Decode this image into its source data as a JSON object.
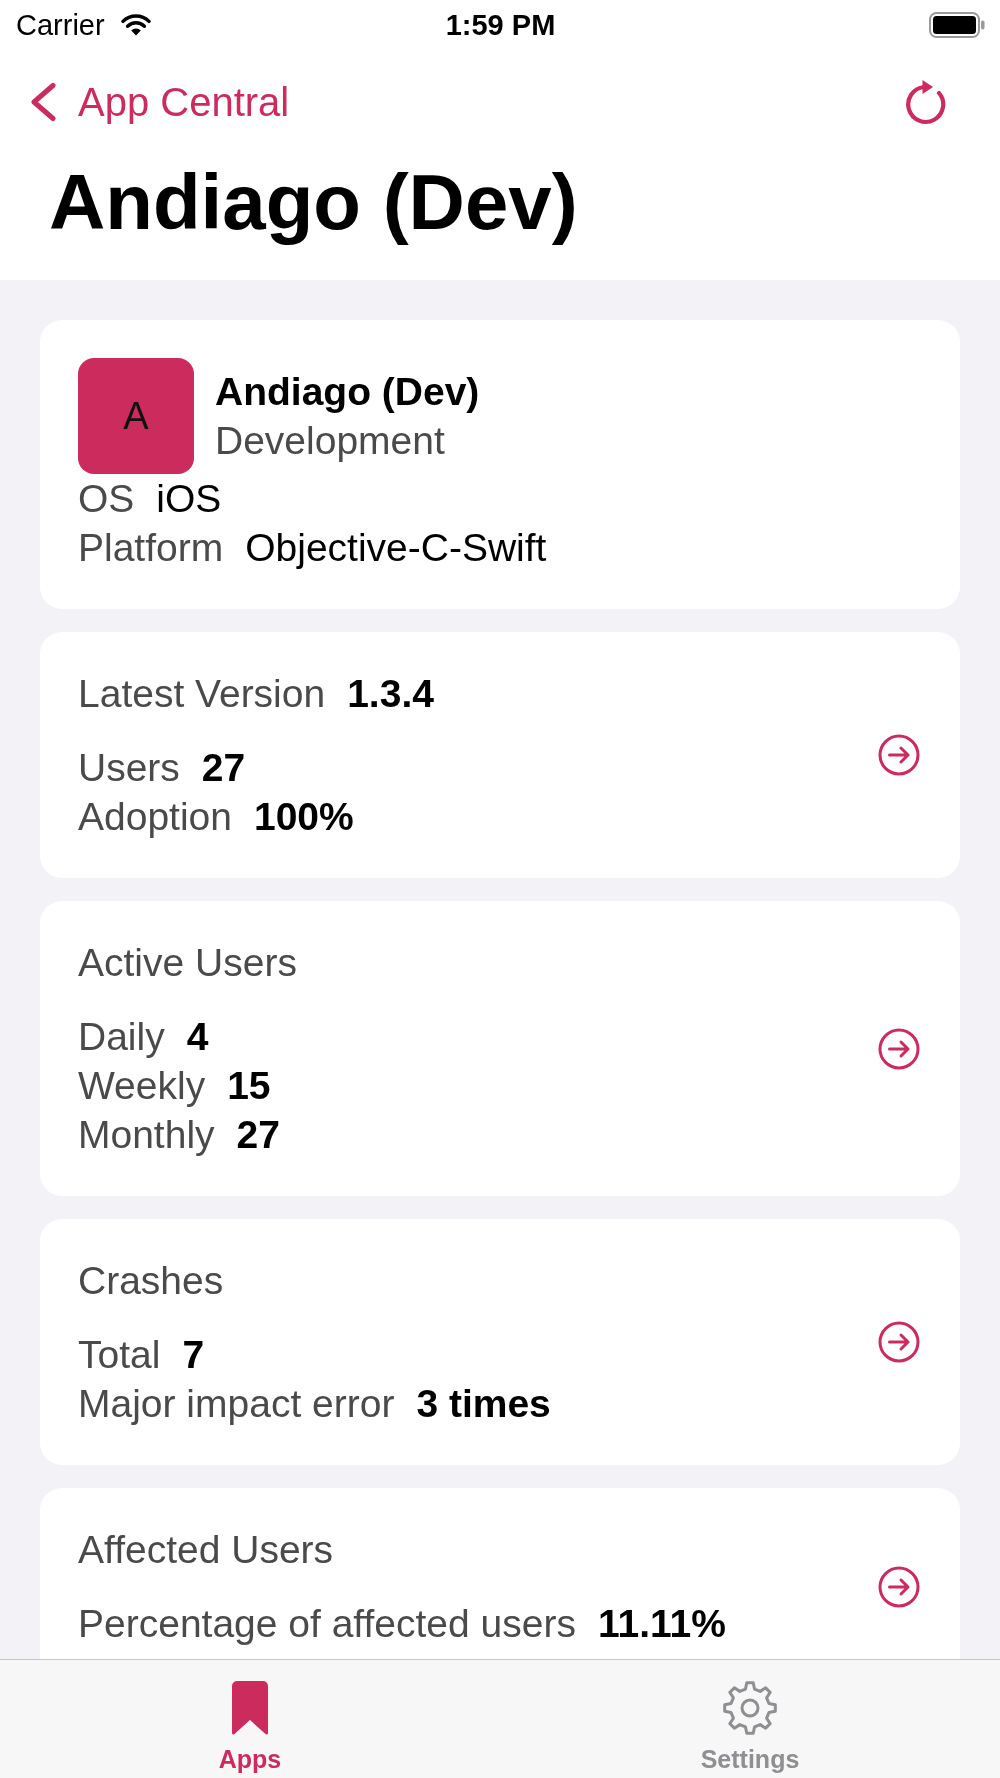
{
  "status_bar": {
    "carrier": "Carrier",
    "time": "1:59 PM"
  },
  "nav_bar": {
    "back_label": "App Central",
    "title": "Andiago (Dev)"
  },
  "app_card": {
    "initial": "A",
    "name": "Andiago (Dev)",
    "environment": "Development",
    "fields": [
      {
        "label": "OS",
        "value": "iOS"
      },
      {
        "label": "Platform",
        "value": "Objective-C-Swift"
      }
    ]
  },
  "stat_cards": [
    {
      "title": "Latest Version",
      "title_value": "1.3.4",
      "rows": [
        {
          "label": "Users",
          "value": "27"
        },
        {
          "label": "Adoption",
          "value": "100%"
        }
      ]
    },
    {
      "title": "Active Users",
      "rows": [
        {
          "label": "Daily",
          "value": "4"
        },
        {
          "label": "Weekly",
          "value": "15"
        },
        {
          "label": "Monthly",
          "value": "27"
        }
      ]
    },
    {
      "title": "Crashes",
      "rows": [
        {
          "label": "Total",
          "value": "7"
        },
        {
          "label": "Major impact error",
          "value": "3 times"
        }
      ]
    },
    {
      "title": "Affected Users",
      "rows": [
        {
          "label": "Percentage of affected users",
          "value": "11.11%"
        }
      ]
    }
  ],
  "tab_bar": {
    "tabs": [
      {
        "label": "Apps",
        "selected": true
      },
      {
        "label": "Settings",
        "selected": false
      }
    ]
  }
}
